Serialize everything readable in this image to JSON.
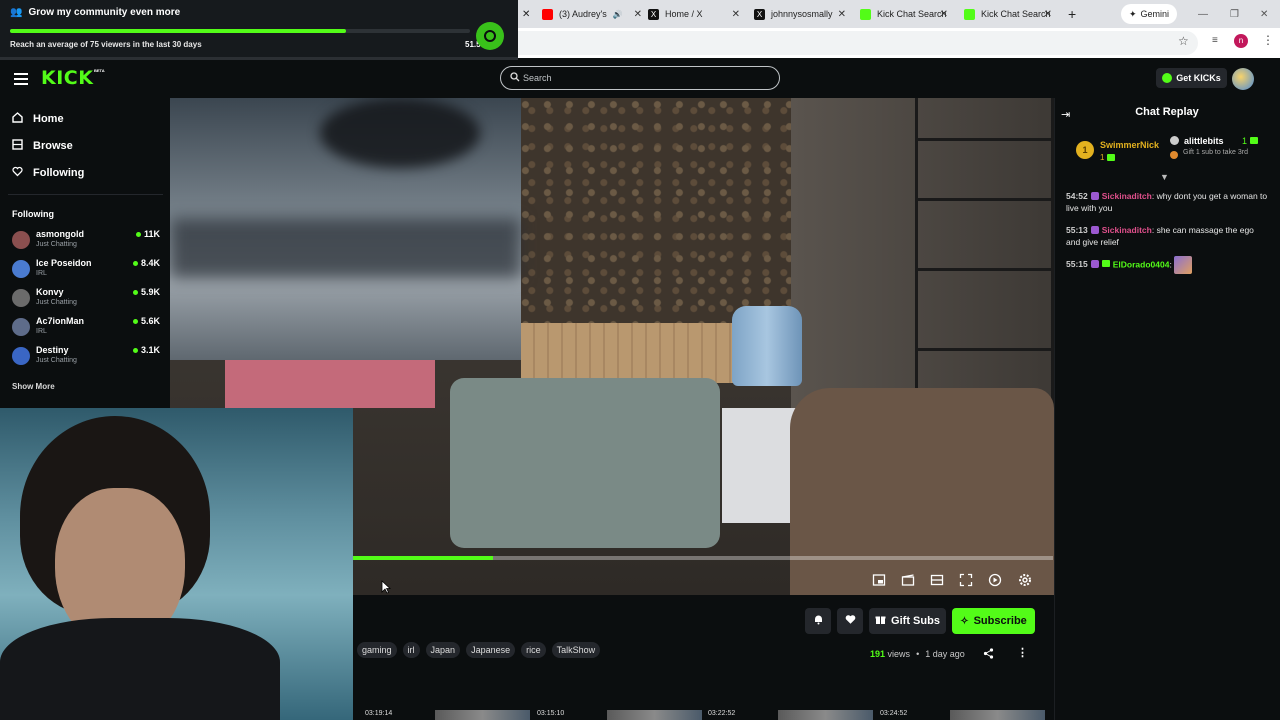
{
  "browser": {
    "tabs": [
      {
        "label": "(3) Audrey's",
        "color": "#ff0000"
      },
      {
        "label": "Home / X",
        "color": "#000000"
      },
      {
        "label": "johnnysosmally",
        "color": "#000000"
      },
      {
        "label": "Kick Chat Search",
        "color": "#53fc18"
      },
      {
        "label": "Kick Chat Search",
        "color": "#53fc18"
      }
    ],
    "gemini_label": "Gemini"
  },
  "notification": {
    "title": "Grow my community even more",
    "subtitle": "Reach an average of 75 viewers in the last 30 days",
    "percent_text": "51.5",
    "progress": 0.73
  },
  "header": {
    "logo": "KICK",
    "beta": "BETA",
    "search_placeholder": "Search",
    "get_kicks": "Get KICKs"
  },
  "sidebar": {
    "nav": [
      {
        "label": "Home",
        "icon": "home-icon"
      },
      {
        "label": "Browse",
        "icon": "browse-icon"
      },
      {
        "label": "Following",
        "icon": "heart-icon"
      }
    ],
    "following_title": "Following",
    "channels": [
      {
        "name": "asmongold",
        "category": "Just Chatting",
        "viewers": "11K",
        "color": "#8a4f4f"
      },
      {
        "name": "Ice Poseidon",
        "category": "IRL",
        "viewers": "8.4K",
        "color": "#4a7bd0"
      },
      {
        "name": "Konvy",
        "category": "Just Chatting",
        "viewers": "5.9K",
        "color": "#6b6b6b"
      },
      {
        "name": "Ac7ionMan",
        "category": "IRL",
        "viewers": "5.6K",
        "color": "#5e6c8a"
      },
      {
        "name": "Destiny",
        "category": "Just Chatting",
        "viewers": "3.1K",
        "color": "#3a66c4"
      }
    ],
    "show_more": "Show More"
  },
  "player": {
    "progress": 0.2
  },
  "actions": {
    "gift_subs": "Gift Subs",
    "subscribe": "Subscribe"
  },
  "tags": [
    "gaming",
    "irl",
    "Japan",
    "Japanese",
    "rice",
    "TalkShow"
  ],
  "meta": {
    "views_count": "191",
    "views_label": "views",
    "separator": "•",
    "age": "1 day ago"
  },
  "thumbnails": [
    {
      "time": "03:19:14"
    },
    {
      "time": "03:15:10"
    },
    {
      "time": "03:22:52"
    },
    {
      "time": "03:24:52"
    }
  ],
  "chat": {
    "title": "Chat Replay",
    "top_gifters": [
      {
        "rank": "1",
        "name": "SwimmerNick",
        "count": "1"
      },
      {
        "name": "alittlebits",
        "count": "1",
        "note": "Gift 1 sub to take 3rd"
      }
    ],
    "messages": [
      {
        "time": "54:52",
        "user": "Sickinaditch",
        "text": "why dont you get a woman to live with you"
      },
      {
        "time": "55:13",
        "user": "Sickinaditch",
        "text": "she can massage the ego and give relief"
      },
      {
        "time": "55:15",
        "user": "ElDorado0404",
        "text": ""
      }
    ]
  }
}
